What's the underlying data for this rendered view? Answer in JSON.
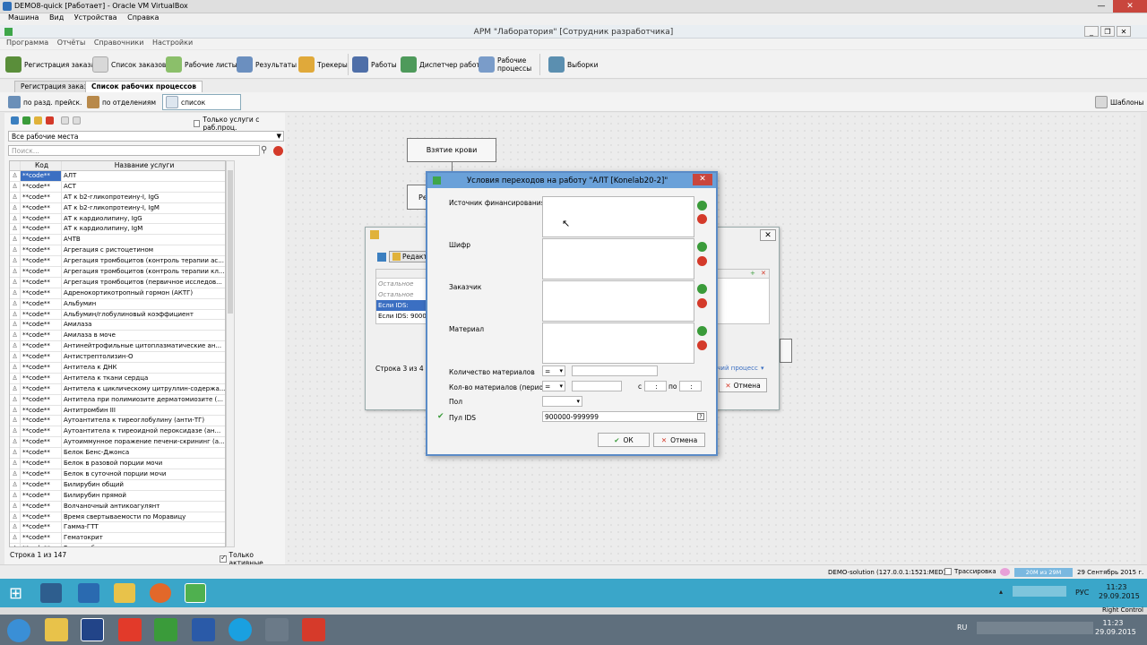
{
  "host_window": {
    "title": "DEMO8-quick [Работает] - Oracle VM VirtualBox",
    "menu": [
      "Машина",
      "Вид",
      "Устройства",
      "Справка"
    ]
  },
  "guest_window": {
    "title": "АРМ \"Лаборатория\" [Сотрудник разработчика]",
    "menu": [
      "Программа",
      "Отчёты",
      "Справочники",
      "Настройки"
    ]
  },
  "toolbar": {
    "order_registration": "Регистрация заказа",
    "order_list": "Список заказов",
    "worksheets": "Рабочие листы",
    "results": "Результаты",
    "trackers": "Трекеры",
    "jobs": "Работы",
    "dispatcher": "Диспетчер работ",
    "workflows_l1": "Рабочие",
    "workflows_l2": "процессы",
    "samples": "Выборки"
  },
  "tabs": {
    "tab1": "Регистрация заказа",
    "tab2": "Список рабочих процессов"
  },
  "subtoolbar": {
    "by_price_section": "по разд. прейск.",
    "by_department": "по отделениям",
    "list": "список",
    "templates": "Шаблоны"
  },
  "left_panel": {
    "only_with_processes": "Только услуги с раб.проц.",
    "workplaces_combo": "Все рабочие места",
    "search_placeholder": "Поиск...",
    "col_code": "Код услуги",
    "col_name": "Название услуги",
    "rows": [
      {
        "code": "**code**",
        "name": "АЛТ"
      },
      {
        "code": "**code**",
        "name": "АСТ"
      },
      {
        "code": "**code**",
        "name": "АТ к b2-гликопротеину-I, IgG"
      },
      {
        "code": "**code**",
        "name": "АТ к b2-гликопротеину-I, IgM"
      },
      {
        "code": "**code**",
        "name": "АТ к кардиолипину, IgG"
      },
      {
        "code": "**code**",
        "name": "АТ к кардиолипину, IgM"
      },
      {
        "code": "**code**",
        "name": "АЧТВ"
      },
      {
        "code": "**code**",
        "name": "Агрегация с ристоцетином"
      },
      {
        "code": "**code**",
        "name": "Агрегация тромбоцитов (контроль терапии ас..."
      },
      {
        "code": "**code**",
        "name": "Агрегация тромбоцитов (контроль терапии кл..."
      },
      {
        "code": "**code**",
        "name": "Агрегация тромбоцитов (первичное исследов..."
      },
      {
        "code": "**code**",
        "name": "Адренокортикотропный гормон (АКТГ)"
      },
      {
        "code": "**code**",
        "name": "Альбумин"
      },
      {
        "code": "**code**",
        "name": "Альбумин/глобулиновый коэффициент"
      },
      {
        "code": "**code**",
        "name": "Амилаза"
      },
      {
        "code": "**code**",
        "name": "Амилаза в моче"
      },
      {
        "code": "**code**",
        "name": "Антинейтрофильные цитоплазматические ан..."
      },
      {
        "code": "**code**",
        "name": "Антистрептолизин-О"
      },
      {
        "code": "**code**",
        "name": "Антитела к ДНК"
      },
      {
        "code": "**code**",
        "name": "Антитела к ткани сердца"
      },
      {
        "code": "**code**",
        "name": "Антитела к циклическому цитруллин-содержа..."
      },
      {
        "code": "**code**",
        "name": "Антитела при полимиозите дерматомиозите (..."
      },
      {
        "code": "**code**",
        "name": "Антитромбин III"
      },
      {
        "code": "**code**",
        "name": "Аутоантитела к тиреоглобулину (анти-ТГ)"
      },
      {
        "code": "**code**",
        "name": "Аутоантитела к тиреоидной пероксидазе (ан..."
      },
      {
        "code": "**code**",
        "name": "Аутоиммунное поражение печени-скрининг (а..."
      },
      {
        "code": "**code**",
        "name": "Белок Бенс-Джонса"
      },
      {
        "code": "**code**",
        "name": "Белок в разовой порции мочи"
      },
      {
        "code": "**code**",
        "name": "Белок в суточной порции мочи"
      },
      {
        "code": "**code**",
        "name": "Билирубин общий"
      },
      {
        "code": "**code**",
        "name": "Билирубин прямой"
      },
      {
        "code": "**code**",
        "name": "Волчаночный антикоагулянт"
      },
      {
        "code": "**code**",
        "name": "Время свертываемости по Моравицу"
      },
      {
        "code": "**code**",
        "name": "Гамма-ГТТ"
      },
      {
        "code": "**code**",
        "name": "Гематокрит"
      },
      {
        "code": "**code**",
        "name": "Гемоглобин"
      }
    ],
    "row_count": "Строка 1 из 147",
    "only_active": "Только активные"
  },
  "canvas": {
    "node1": "Взятие крови",
    "node2": "Ре"
  },
  "back_dialog": {
    "edit_label": "Редакт",
    "rows": [
      "Остальное",
      "Остальное",
      "Если IDS: 900000",
      "Если IDS: 900000"
    ],
    "row_count": "Строка 3 из 4",
    "process_link": "очий процесс",
    "cancel": "Отмена"
  },
  "dialog": {
    "title": "Условия переходов на работу \"АЛТ [Konelab20-2]\"",
    "funding_source": "Источник финансирования",
    "cipher": "Шифр",
    "customer": "Заказчик",
    "material": "Материал",
    "material_qty": "Количество материалов",
    "material_qty_op": "=",
    "material_qty_period": "Кол-во материалов (период)",
    "material_qty_period_op": "=",
    "from_label": "с",
    "from_value": ":",
    "to_label": "по",
    "to_value": ":",
    "sex": "Пол",
    "ids_pool": "Пул IDS",
    "ids_pool_value": "900000-999999",
    "ok": "ОК",
    "cancel": "Отмена"
  },
  "statusbar": {
    "connection": "DEMO-solution (127.0.0.1:1521:MED)",
    "tracing": "Трассировка",
    "memory": "20M из 29M",
    "date": "29 Сентябрь 2015 г."
  },
  "guest_tray": {
    "lang": "РУС",
    "time": "11:23",
    "date": "29.09.2015"
  },
  "host_tray": {
    "lang": "RU",
    "time": "11:23",
    "date": "29.09.2015",
    "right_control": "Right Control"
  },
  "colors": {
    "dialog_title": "#6aa1d9",
    "selection": "#3b6fc2",
    "guest_taskbar": "#3aa6c9",
    "close_red": "#c9463d"
  }
}
